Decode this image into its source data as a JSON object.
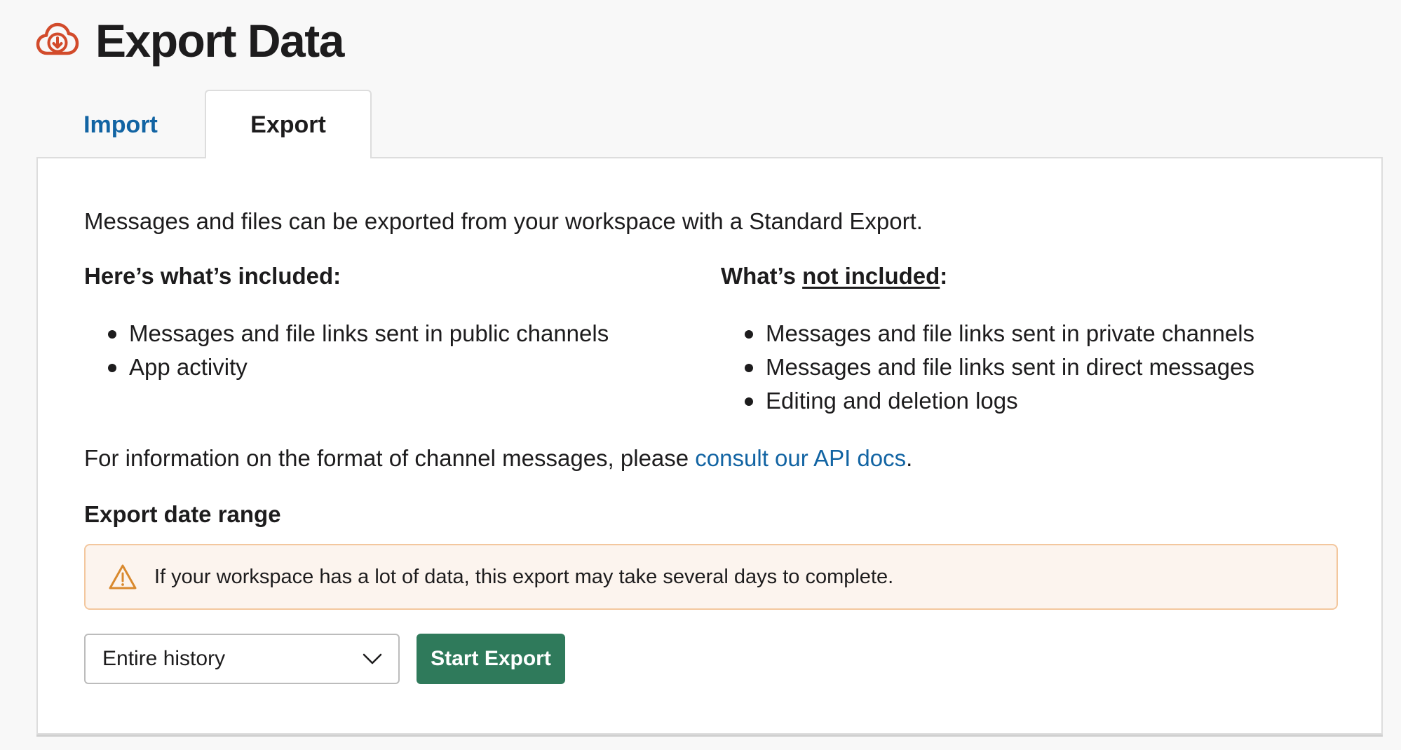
{
  "header": {
    "title": "Export Data",
    "icon": "cloud-download-icon",
    "icon_color": "#d24b2b"
  },
  "tabs": [
    {
      "label": "Import",
      "active": false
    },
    {
      "label": "Export",
      "active": true
    }
  ],
  "content": {
    "intro": "Messages and files can be exported from your workspace with a Standard Export.",
    "included": {
      "heading": "Here’s what’s included:",
      "items": [
        "Messages and file links sent in public channels",
        "App activity"
      ]
    },
    "not_included": {
      "heading_prefix": "What’s ",
      "heading_emphasis": "not included",
      "heading_suffix": ":",
      "items": [
        "Messages and file links sent in private channels",
        "Messages and file links sent in direct messages",
        "Editing and deletion logs"
      ]
    },
    "info_prefix": "For information on the format of channel messages, please ",
    "info_link": "consult our API docs",
    "info_suffix": ".",
    "range_heading": "Export date range",
    "warning": {
      "icon": "warning-triangle-icon",
      "text": "If your workspace has a lot of data, this export may take several days to complete."
    },
    "date_range_select": {
      "value": "Entire history"
    },
    "start_button_label": "Start Export"
  },
  "colors": {
    "link": "#1264a3",
    "primary_button": "#2f7a5b",
    "warning_bg": "#fcf4ee",
    "warning_border": "#f3c79e",
    "warning_icon": "#d9892e"
  }
}
